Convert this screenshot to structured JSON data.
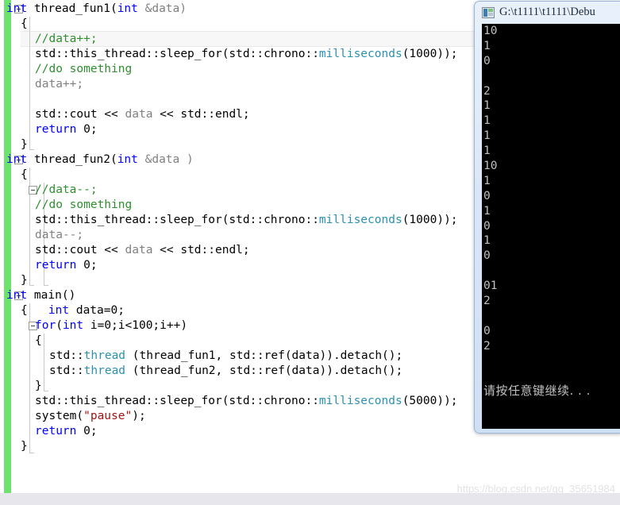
{
  "editor": {
    "language": "cpp",
    "change_bar_color": "#6ce36c",
    "current_line_index": 2,
    "lines": [
      {
        "indent": 0,
        "fold": true,
        "segments": [
          {
            "t": "int ",
            "c": "kw"
          },
          {
            "t": "thread_fun1(",
            "c": "plain"
          },
          {
            "t": "int ",
            "c": "kw"
          },
          {
            "t": "&data)",
            "c": "gray"
          }
        ]
      },
      {
        "indent": 1,
        "fold": false,
        "segments": [
          {
            "t": "{",
            "c": "plain"
          }
        ]
      },
      {
        "indent": 2,
        "fold": false,
        "segments": [
          {
            "t": "//data++;",
            "c": "cmt"
          }
        ]
      },
      {
        "indent": 2,
        "fold": false,
        "segments": [
          {
            "t": "std::this_thread::sleep_for(std::chrono::",
            "c": "plain"
          },
          {
            "t": "milliseconds",
            "c": "type"
          },
          {
            "t": "(1000));",
            "c": "plain"
          }
        ]
      },
      {
        "indent": 2,
        "fold": false,
        "segments": [
          {
            "t": "//do something",
            "c": "cmt"
          }
        ]
      },
      {
        "indent": 2,
        "fold": false,
        "segments": [
          {
            "t": "data++;",
            "c": "gray"
          }
        ]
      },
      {
        "indent": 2,
        "fold": false,
        "segments": [
          {
            "t": "",
            "c": "plain"
          }
        ]
      },
      {
        "indent": 2,
        "fold": false,
        "segments": [
          {
            "t": "std::cout << ",
            "c": "plain"
          },
          {
            "t": "data",
            "c": "gray"
          },
          {
            "t": " << std::endl;",
            "c": "plain"
          }
        ]
      },
      {
        "indent": 2,
        "fold": false,
        "segments": [
          {
            "t": "return ",
            "c": "kw"
          },
          {
            "t": "0;",
            "c": "plain"
          }
        ]
      },
      {
        "indent": 1,
        "fold": false,
        "segments": [
          {
            "t": "}",
            "c": "plain"
          }
        ]
      },
      {
        "indent": 0,
        "fold": true,
        "segments": [
          {
            "t": "int ",
            "c": "kw"
          },
          {
            "t": "thread_fun2(",
            "c": "plain"
          },
          {
            "t": "int ",
            "c": "kw"
          },
          {
            "t": "&data )",
            "c": "gray"
          }
        ]
      },
      {
        "indent": 1,
        "fold": false,
        "segments": [
          {
            "t": "{",
            "c": "plain"
          }
        ]
      },
      {
        "indent": 2,
        "fold": true,
        "segments": [
          {
            "t": "//data--;",
            "c": "cmt"
          }
        ]
      },
      {
        "indent": 2,
        "fold": false,
        "segments": [
          {
            "t": "//do something",
            "c": "cmt"
          }
        ]
      },
      {
        "indent": 2,
        "fold": false,
        "segments": [
          {
            "t": "std::this_thread::sleep_for(std::chrono::",
            "c": "plain"
          },
          {
            "t": "milliseconds",
            "c": "type"
          },
          {
            "t": "(1000));",
            "c": "plain"
          }
        ]
      },
      {
        "indent": 2,
        "fold": false,
        "segments": [
          {
            "t": "data--;",
            "c": "gray"
          }
        ]
      },
      {
        "indent": 2,
        "fold": false,
        "segments": [
          {
            "t": "std::cout << ",
            "c": "plain"
          },
          {
            "t": "data",
            "c": "gray"
          },
          {
            "t": " << std::endl;",
            "c": "plain"
          }
        ]
      },
      {
        "indent": 2,
        "fold": false,
        "segments": [
          {
            "t": "return ",
            "c": "kw"
          },
          {
            "t": "0;",
            "c": "plain"
          }
        ]
      },
      {
        "indent": 1,
        "fold": false,
        "segments": [
          {
            "t": "}",
            "c": "plain"
          }
        ]
      },
      {
        "indent": 0,
        "fold": true,
        "segments": [
          {
            "t": "int ",
            "c": "kw"
          },
          {
            "t": "main()",
            "c": "plain"
          }
        ]
      },
      {
        "indent": 1,
        "fold": false,
        "segments": [
          {
            "t": "{   ",
            "c": "plain"
          },
          {
            "t": "int ",
            "c": "kw"
          },
          {
            "t": "data=0;",
            "c": "plain"
          }
        ]
      },
      {
        "indent": 2,
        "fold": true,
        "segments": [
          {
            "t": "for",
            "c": "kw"
          },
          {
            "t": "(",
            "c": "plain"
          },
          {
            "t": "int ",
            "c": "kw"
          },
          {
            "t": "i=0;i<100;i++)",
            "c": "plain"
          }
        ]
      },
      {
        "indent": 2,
        "fold": false,
        "segments": [
          {
            "t": "{",
            "c": "plain"
          }
        ]
      },
      {
        "indent": 3,
        "fold": false,
        "segments": [
          {
            "t": "std::",
            "c": "plain"
          },
          {
            "t": "thread",
            "c": "type"
          },
          {
            "t": " (thread_fun1, std::ref(data)).detach();",
            "c": "plain"
          }
        ]
      },
      {
        "indent": 3,
        "fold": false,
        "segments": [
          {
            "t": "std::",
            "c": "plain"
          },
          {
            "t": "thread",
            "c": "type"
          },
          {
            "t": " (thread_fun2, std::ref(data)).detach();",
            "c": "plain"
          }
        ]
      },
      {
        "indent": 2,
        "fold": false,
        "segments": [
          {
            "t": "}",
            "c": "plain"
          }
        ]
      },
      {
        "indent": 2,
        "fold": false,
        "segments": [
          {
            "t": "std::this_thread::sleep_for(std::chrono::",
            "c": "plain"
          },
          {
            "t": "milliseconds",
            "c": "type"
          },
          {
            "t": "(5000));",
            "c": "plain"
          }
        ]
      },
      {
        "indent": 2,
        "fold": false,
        "segments": [
          {
            "t": "system(",
            "c": "plain"
          },
          {
            "t": "\"pause\"",
            "c": "str"
          },
          {
            "t": ");",
            "c": "plain"
          }
        ]
      },
      {
        "indent": 2,
        "fold": false,
        "segments": [
          {
            "t": "return ",
            "c": "kw"
          },
          {
            "t": "0;",
            "c": "plain"
          }
        ]
      },
      {
        "indent": 1,
        "fold": false,
        "segments": [
          {
            "t": "}",
            "c": "plain"
          }
        ]
      }
    ]
  },
  "console": {
    "title": "G:\\t1111\\t1111\\Debu",
    "icon": "console-icon",
    "background": "#000000",
    "text_color": "#c0c0c0",
    "output_lines": [
      "10",
      "1",
      "0",
      "",
      "2",
      "1",
      "1",
      "1",
      "1",
      "10",
      "1",
      "0",
      "1",
      "0",
      "1",
      "0",
      "",
      "01",
      "2",
      "",
      "0",
      "2",
      "",
      ""
    ],
    "prompt": "请按任意键继续. . ."
  },
  "watermark": {
    "text": "https://blog.csdn.net/qq_35651984"
  }
}
